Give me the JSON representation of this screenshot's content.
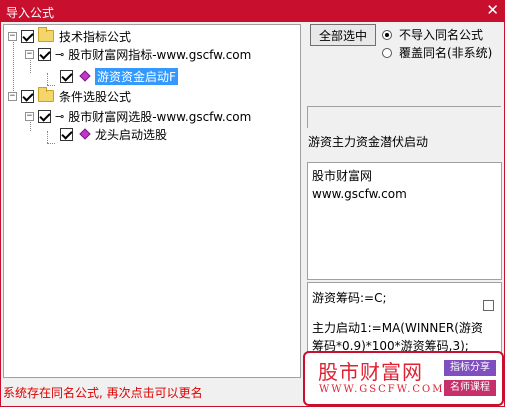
{
  "window": {
    "title": "导入公式"
  },
  "tree": {
    "nodes": [
      {
        "label": "技术指标公式"
      },
      {
        "label": "股市财富网指标-www.gscfw.com"
      },
      {
        "label": "游资资金启动F"
      },
      {
        "label": "条件选股公式"
      },
      {
        "label": "股市财富网选股-www.gscfw.com"
      },
      {
        "label": "龙头启动选股"
      }
    ]
  },
  "options": {
    "select_all": "全部选中",
    "radio_skip": "不导入同名公式",
    "radio_overwrite": "覆盖同名(非系统)"
  },
  "formula": {
    "description": "游资主力资金潜伏启动",
    "author": "股市财富网",
    "site": "www.gscfw.com",
    "code_line1": "游资筹码:=C;",
    "code_line2": "主力启动1:=MA(WINNER(游资筹码*0.9)*100*游资筹码,3);"
  },
  "status": "系统存在同名公式, 再次点击可以更名",
  "watermark": {
    "brand": "股市财富网",
    "url": "WWW.GSCFW.COM",
    "tag1": "指标分享",
    "tag2": "名师课程"
  }
}
